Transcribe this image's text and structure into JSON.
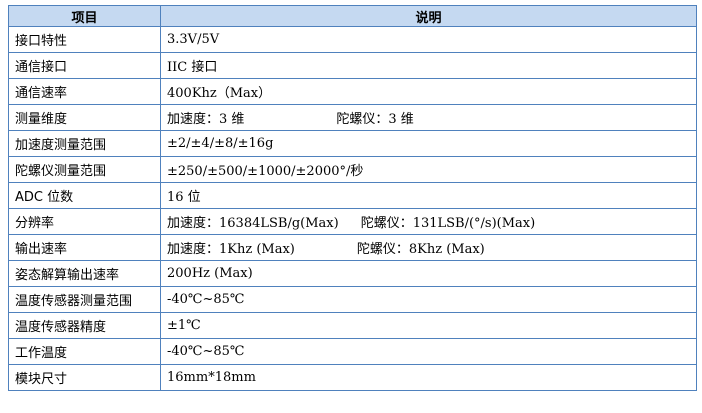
{
  "header": {
    "item": "项目",
    "description": "说明"
  },
  "rows": [
    {
      "name": "接口特性",
      "value": "3.3V/5V"
    },
    {
      "name": "通信接口",
      "value": "IIC 接口"
    },
    {
      "name": "通信速率",
      "value": "400Khz（Max）"
    },
    {
      "name": "测量维度",
      "value_a": "加速度：3 维",
      "value_b": "陀螺仪：3 维"
    },
    {
      "name": "加速度测量范围",
      "value": "±2/±4/±8/±16g"
    },
    {
      "name": "陀螺仪测量范围",
      "value": "±250/±500/±1000/±2000°/秒"
    },
    {
      "name": "ADC 位数",
      "value": "16 位"
    },
    {
      "name": "分辨率",
      "value_a": "加速度：16384LSB/g(Max)",
      "value_b": "陀螺仪：131LSB/(°/s)(Max)"
    },
    {
      "name": "输出速率",
      "value_a": "加速度：1Khz (Max)",
      "value_b": "陀螺仪：8Khz (Max)"
    },
    {
      "name": "姿态解算输出速率",
      "value": "200Hz (Max)"
    },
    {
      "name": "温度传感器测量范围",
      "value": "-40℃~85℃"
    },
    {
      "name": "温度传感器精度",
      "value": "±1℃"
    },
    {
      "name": "工作温度",
      "value": "-40℃~85℃"
    },
    {
      "name": "模块尺寸",
      "value": "16mm*18mm"
    }
  ]
}
